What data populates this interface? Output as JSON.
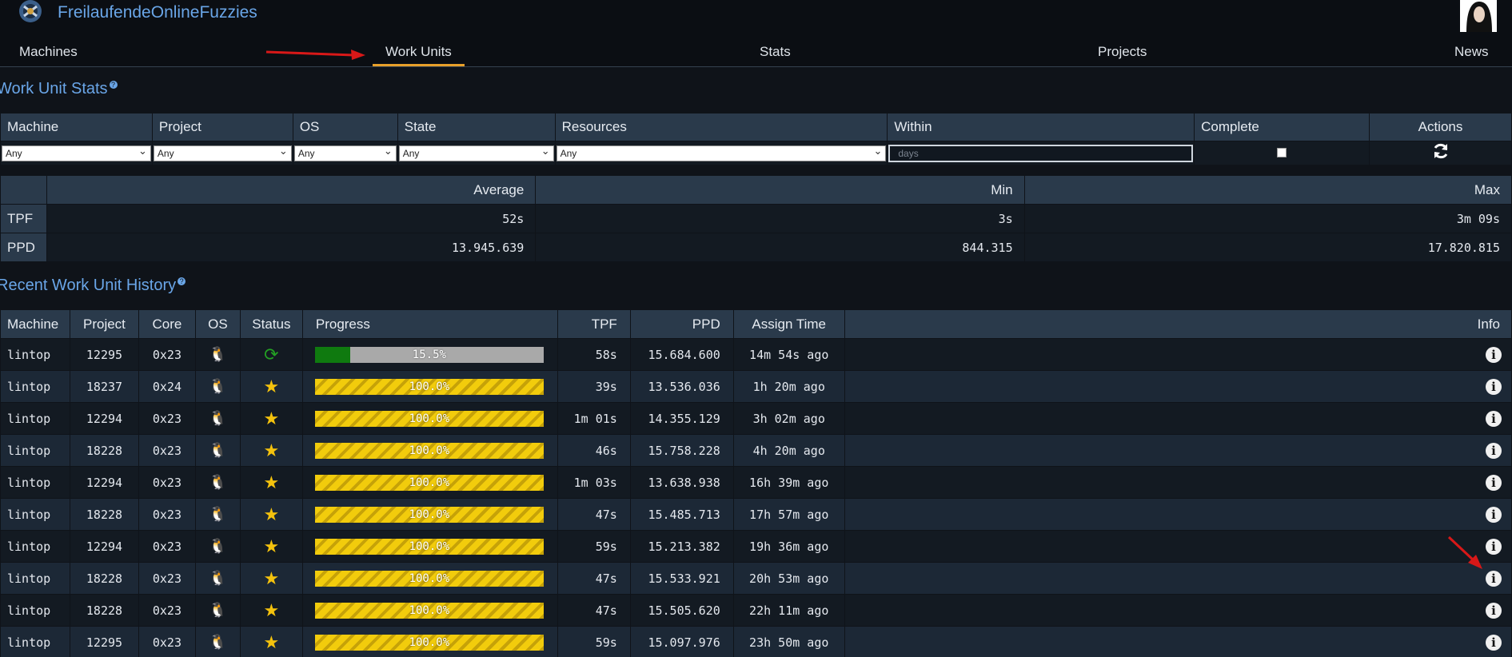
{
  "site": {
    "title": "FreilaufendeOnlineFuzzies"
  },
  "nav": {
    "machines": "Machines",
    "work_units": "Work Units",
    "stats": "Stats",
    "projects": "Projects",
    "news": "News"
  },
  "wu_stats": {
    "title": "Work Unit Stats",
    "filter_headers": [
      "Machine",
      "Project",
      "OS",
      "State",
      "Resources",
      "Within",
      "Complete",
      "Actions"
    ],
    "machine_value": "Any",
    "project_value": "Any",
    "os_value": "Any",
    "state_value": "Any",
    "resources_value": "Any",
    "within_placeholder": "days",
    "complete_checked": false,
    "actions_icon": "refresh-icon"
  },
  "summary": {
    "headers": [
      "Average",
      "Min",
      "Max"
    ],
    "rows": [
      {
        "label": "TPF",
        "average": "52s",
        "min": "3s",
        "max": "3m 09s"
      },
      {
        "label": "PPD",
        "average": "13.945.639",
        "min": "844.315",
        "max": "17.820.815"
      }
    ]
  },
  "history": {
    "title": "Recent Work Unit History",
    "headers": [
      "Machine",
      "Project",
      "Core",
      "OS",
      "Status",
      "Progress",
      "TPF",
      "PPD",
      "Assign Time",
      "Info"
    ],
    "rows": [
      {
        "machine": "lintop",
        "project": "12295",
        "core": "0x23",
        "os": "linux-icon",
        "status": "running-icon",
        "progress": 15.5,
        "progress_label": "15.5%",
        "tpf": "58s",
        "ppd": "15.684.600",
        "assign": "14m 54s ago"
      },
      {
        "machine": "lintop",
        "project": "18237",
        "core": "0x24",
        "os": "linux-icon",
        "status": "star-icon",
        "progress": 100,
        "progress_label": "100.0%",
        "tpf": "39s",
        "ppd": "13.536.036",
        "assign": "1h 20m ago"
      },
      {
        "machine": "lintop",
        "project": "12294",
        "core": "0x23",
        "os": "linux-icon",
        "status": "star-icon",
        "progress": 100,
        "progress_label": "100.0%",
        "tpf": "1m 01s",
        "ppd": "14.355.129",
        "assign": "3h 02m ago"
      },
      {
        "machine": "lintop",
        "project": "18228",
        "core": "0x23",
        "os": "linux-icon",
        "status": "star-icon",
        "progress": 100,
        "progress_label": "100.0%",
        "tpf": "46s",
        "ppd": "15.758.228",
        "assign": "4h 20m ago"
      },
      {
        "machine": "lintop",
        "project": "12294",
        "core": "0x23",
        "os": "linux-icon",
        "status": "star-icon",
        "progress": 100,
        "progress_label": "100.0%",
        "tpf": "1m 03s",
        "ppd": "13.638.938",
        "assign": "16h 39m ago"
      },
      {
        "machine": "lintop",
        "project": "18228",
        "core": "0x23",
        "os": "linux-icon",
        "status": "star-icon",
        "progress": 100,
        "progress_label": "100.0%",
        "tpf": "47s",
        "ppd": "15.485.713",
        "assign": "17h 57m ago"
      },
      {
        "machine": "lintop",
        "project": "12294",
        "core": "0x23",
        "os": "linux-icon",
        "status": "star-icon",
        "progress": 100,
        "progress_label": "100.0%",
        "tpf": "59s",
        "ppd": "15.213.382",
        "assign": "19h 36m ago"
      },
      {
        "machine": "lintop",
        "project": "18228",
        "core": "0x23",
        "os": "linux-icon",
        "status": "star-icon",
        "progress": 100,
        "progress_label": "100.0%",
        "tpf": "47s",
        "ppd": "15.533.921",
        "assign": "20h 53m ago"
      },
      {
        "machine": "lintop",
        "project": "18228",
        "core": "0x23",
        "os": "linux-icon",
        "status": "star-icon",
        "progress": 100,
        "progress_label": "100.0%",
        "tpf": "47s",
        "ppd": "15.505.620",
        "assign": "22h 11m ago"
      },
      {
        "machine": "lintop",
        "project": "12295",
        "core": "0x23",
        "os": "linux-icon",
        "status": "star-icon",
        "progress": 100,
        "progress_label": "100.0%",
        "tpf": "59s",
        "ppd": "15.097.976",
        "assign": "23h 50m ago"
      }
    ]
  },
  "colors": {
    "accent": "#6aa6e8",
    "active_tab_underline": "#e8a02a",
    "progress_running": "#0f7a0f",
    "progress_done": "#f2cc0c",
    "annotation_arrow": "#d81818"
  }
}
